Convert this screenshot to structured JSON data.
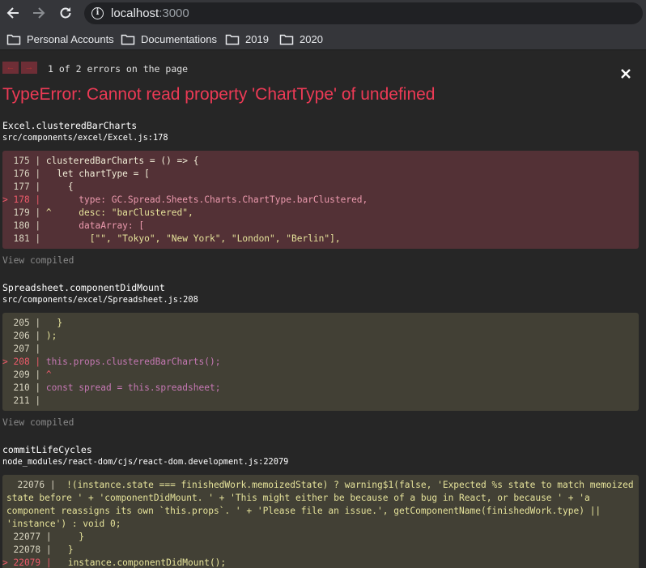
{
  "browser": {
    "url_host": "localhost",
    "url_port": ":3000",
    "bookmarks": [
      "Personal Accounts",
      "Documentations",
      "2019",
      "2020"
    ]
  },
  "overlay": {
    "error_count": "1 of 2 errors on the page",
    "title": "TypeError: Cannot read property 'ChartType' of undefined",
    "view_compiled": "View compiled",
    "frames": [
      {
        "fn": "Excel.clusteredBarCharts",
        "file": "src/components/excel/Excel.js:178",
        "lines": [
          {
            "gutter": "  175 | ",
            "code": "clusteredBarCharts = () => {"
          },
          {
            "gutter": "  176 | ",
            "code": "  let chartType = ["
          },
          {
            "gutter": "  177 | ",
            "code": "    {"
          },
          {
            "gutter": "> 178 | ",
            "code": "      type: GC.Spread.Sheets.Charts.ChartType.barClustered,"
          },
          {
            "gutter": "  179 | ",
            "code": "^     desc: \"barClustered\","
          },
          {
            "gutter": "  180 | ",
            "code": "      dataArray: ["
          },
          {
            "gutter": "  181 | ",
            "code": "        [\"\", \"Tokyo\", \"New York\", \"London\", \"Berlin\"],"
          }
        ]
      },
      {
        "fn": "Spreadsheet.componentDidMount",
        "file": "src/components/excel/Spreadsheet.js:208",
        "lines": [
          {
            "gutter": "  205 | ",
            "code": "  }"
          },
          {
            "gutter": "  206 | ",
            "code": ");"
          },
          {
            "gutter": "  207 | ",
            "code": ""
          },
          {
            "gutter": "> 208 | ",
            "code": "this.props.clusteredBarCharts();"
          },
          {
            "gutter": "  209 | ",
            "code": "^"
          },
          {
            "gutter": "  210 | ",
            "code": "const spread = this.spreadsheet;"
          },
          {
            "gutter": "  211 | ",
            "code": ""
          }
        ]
      },
      {
        "fn": "commitLifeCycles",
        "file": "node_modules/react-dom/cjs/react-dom.development.js:22079",
        "lines": [
          {
            "gutter": "  22076 | ",
            "code": "      !(instance.state === finishedWork.memoizedState) ? warning$1(false, 'Expected %s state to match memoized state before ' + 'componentDidMount. ' + 'This might either be because of a bug in React, or because ' + 'a component reassigns its own `this.props`. ' + 'Please file an issue.', getComponentName(finishedWork.type) || 'instance') : void 0;"
          },
          {
            "gutter": "  22077 | ",
            "code": "    }"
          },
          {
            "gutter": "  22078 | ",
            "code": "  }"
          },
          {
            "gutter": "> 22079 | ",
            "code": "  instance.componentDidMount();"
          }
        ]
      }
    ]
  }
}
